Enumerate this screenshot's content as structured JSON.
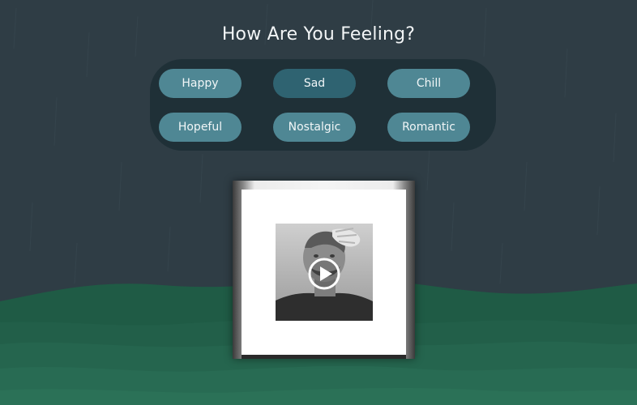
{
  "heading": "How Are You Feeling?",
  "moods": [
    {
      "label": "Happy",
      "selected": false
    },
    {
      "label": "Sad",
      "selected": true
    },
    {
      "label": "Chill",
      "selected": false
    },
    {
      "label": "Hopeful",
      "selected": false
    },
    {
      "label": "Nostalgic",
      "selected": false
    },
    {
      "label": "Romantic",
      "selected": false
    }
  ],
  "colors": {
    "background": "#2f3d45",
    "panel": "#1f3037",
    "button": "#4f8794",
    "button_selected": "#2f6371",
    "wave_dark": "#1d5a45",
    "wave_light": "#2a7055"
  },
  "player": {
    "album_art": "grayscale portrait album cover",
    "play_icon": "play-circle-icon"
  }
}
